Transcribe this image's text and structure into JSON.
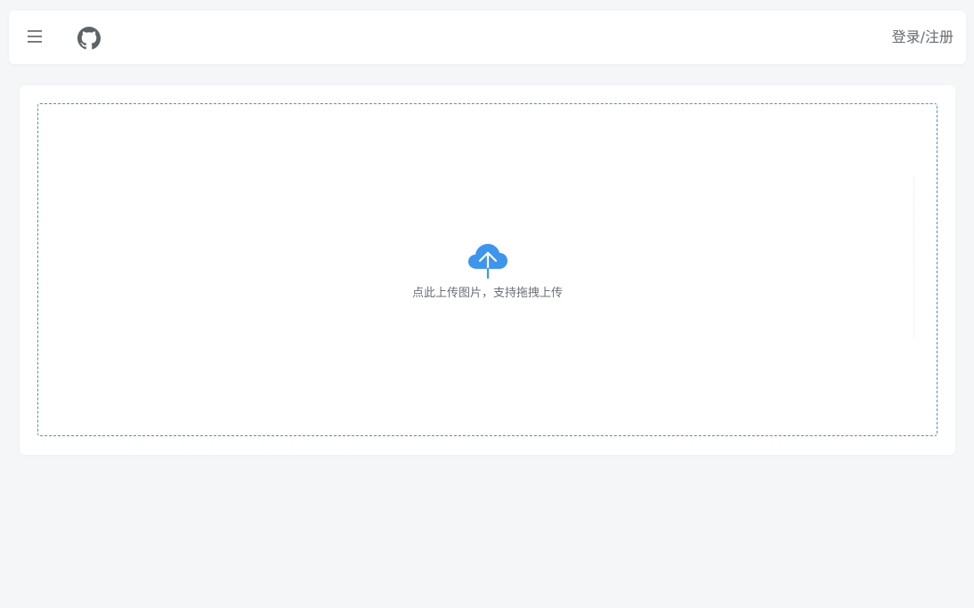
{
  "header": {
    "menu_icon": "hamburger-menu-icon",
    "github_icon": "github-icon",
    "login_label": "登录/注册"
  },
  "upload": {
    "icon": "cloud-upload-icon",
    "hint_text": "点此上传图片，支持拖拽上传",
    "accent_color": "#3d95ee",
    "border_color": "#4a90c8"
  }
}
